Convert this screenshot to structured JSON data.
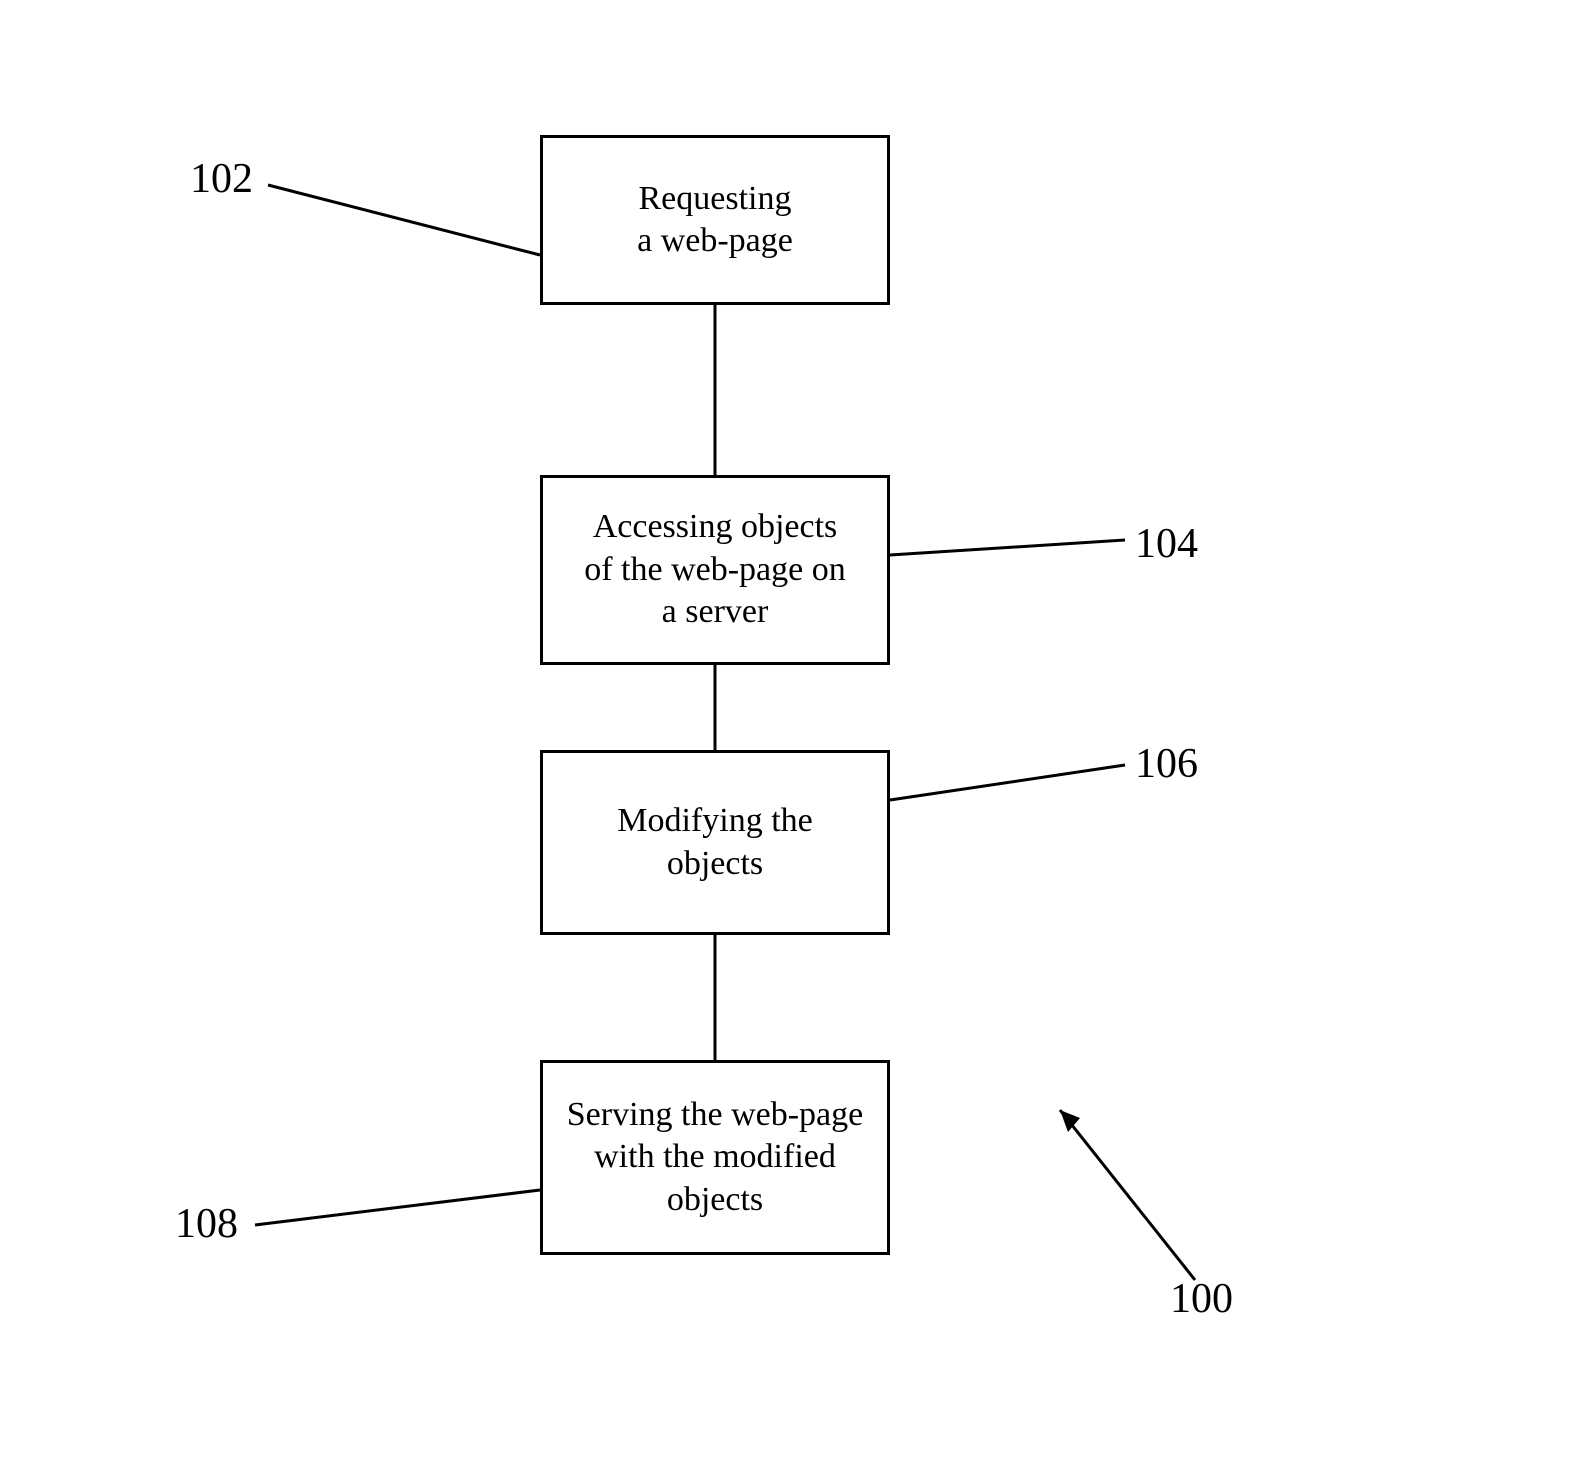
{
  "steps": {
    "s1": {
      "text": "Requesting\na web-page",
      "ref": "102"
    },
    "s2": {
      "text": "Accessing objects\nof the web-page on\na server",
      "ref": "104"
    },
    "s3": {
      "text": "Modifying the\nobjects",
      "ref": "106"
    },
    "s4": {
      "text": "Serving the web-page\nwith the modified\nobjects",
      "ref": "108"
    }
  },
  "diagram_ref": "100"
}
